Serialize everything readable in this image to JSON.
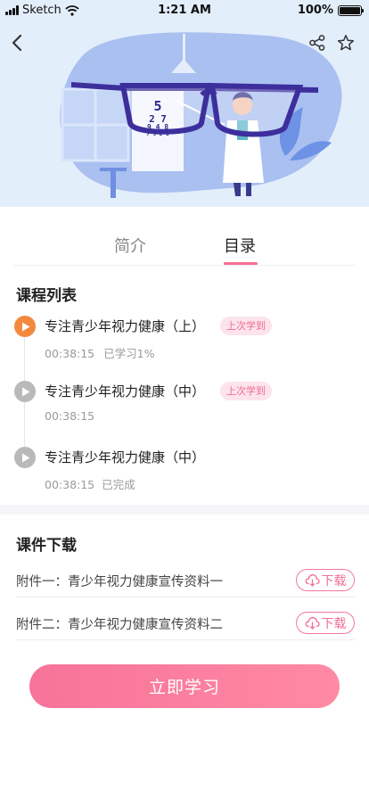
{
  "status_bar": {
    "carrier": "Sketch",
    "time": "1:21 AM",
    "battery": "100%"
  },
  "header": {
    "back_icon": "chevron-left-icon",
    "share_icon": "share-icon",
    "favorite_icon": "star-icon",
    "eye_chart": [
      "5",
      "2 7",
      "9 4 8",
      "7 9 2 1"
    ]
  },
  "tabs": [
    {
      "label": "简介",
      "active": false
    },
    {
      "label": "目录",
      "active": true
    }
  ],
  "course_list": {
    "title": "课程列表",
    "lessons": [
      {
        "title": "专注青少年视力健康（上）",
        "tag": "上次学到",
        "time": "00:38:15",
        "status": "已学习1%",
        "state": "active"
      },
      {
        "title": "专注青少年视力健康（中）",
        "tag": "上次学到",
        "time": "00:38:15",
        "status": "",
        "state": "inactive"
      },
      {
        "title": "专注青少年视力健康（中）",
        "tag": "",
        "time": "00:38:15",
        "status": "已完成",
        "state": "inactive"
      }
    ]
  },
  "downloads": {
    "title": "课件下载",
    "items": [
      {
        "label": "附件一：青少年视力健康宣传资料一",
        "button": "下载"
      },
      {
        "label": "附件二：青少年视力健康宣传资料二",
        "button": "下载"
      }
    ]
  },
  "cta": {
    "label": "立即学习"
  },
  "colors": {
    "accent": "#f46e95",
    "active_play": "#f2893f",
    "inactive_play": "#b9b9b9",
    "hero_bg": "#e3eefb"
  }
}
